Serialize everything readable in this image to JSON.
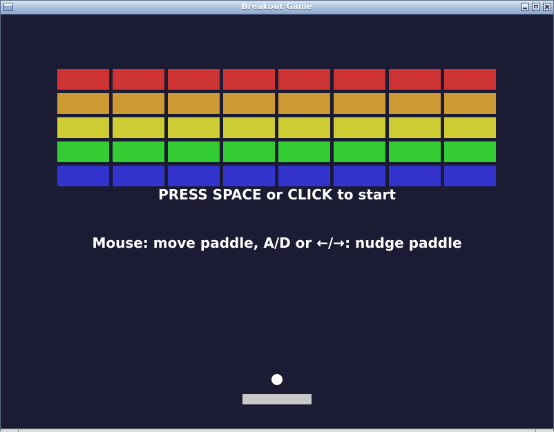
{
  "window": {
    "title": "Breakout Game"
  },
  "game": {
    "background": "#1b1b33",
    "brick_rows": [
      {
        "color": "#cd3333",
        "count": 8
      },
      {
        "color": "#cd9933",
        "count": 8
      },
      {
        "color": "#cdcd33",
        "count": 8
      },
      {
        "color": "#33cd33",
        "count": 8
      },
      {
        "color": "#3333cd",
        "count": 8
      }
    ],
    "start_message": "PRESS SPACE or CLICK to start",
    "help_message": "Mouse: move paddle, A/D or ←/→: nudge paddle",
    "ball_color": "#ffffff",
    "paddle_color": "#c8c8c8"
  }
}
